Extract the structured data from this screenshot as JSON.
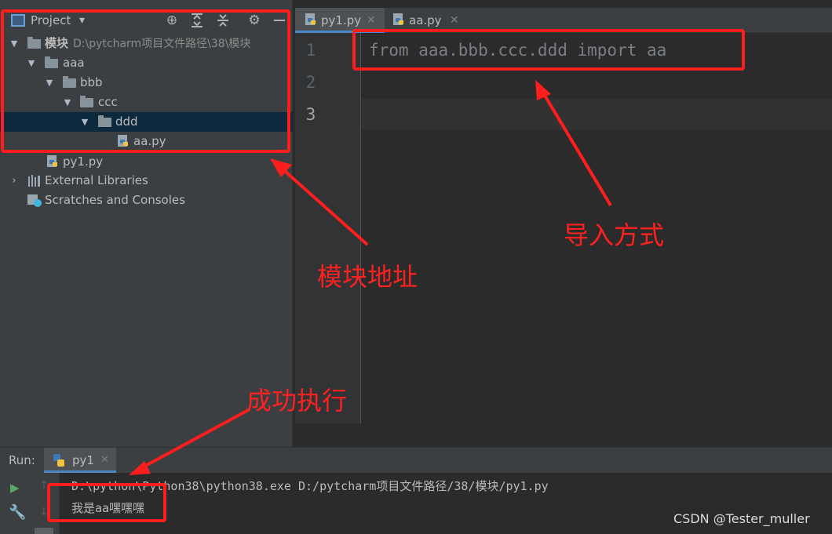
{
  "project_panel": {
    "title": "Project",
    "dropdown_glyph": "▾",
    "toolbar_icons": [
      "crosshair-icon",
      "expand-all-icon",
      "collapse-all-icon",
      "gear-icon",
      "minimize-icon"
    ],
    "tree": [
      {
        "label": "模块",
        "hint": "D:\\pytcharm项目文件路径\\38\\模块",
        "type": "folder",
        "expanded": true
      },
      {
        "label": "aaa",
        "type": "folder",
        "expanded": true
      },
      {
        "label": "bbb",
        "type": "folder",
        "expanded": true
      },
      {
        "label": "ccc",
        "type": "folder",
        "expanded": true
      },
      {
        "label": "ddd",
        "type": "folder",
        "expanded": true,
        "selected": true
      },
      {
        "label": "aa.py",
        "type": "python-file"
      },
      {
        "label": "py1.py",
        "type": "python-file"
      },
      {
        "label": "External Libraries",
        "type": "libraries",
        "expanded": false
      },
      {
        "label": "Scratches and Consoles",
        "type": "scratches"
      }
    ]
  },
  "editor": {
    "tabs": [
      {
        "label": "py1.py",
        "active": true
      },
      {
        "label": "aa.py",
        "active": false
      }
    ],
    "line_numbers": [
      "1",
      "2",
      "3"
    ],
    "code_lines": [
      "from aaa.bbb.ccc.ddd import aa",
      "",
      ""
    ]
  },
  "run_panel": {
    "label": "Run:",
    "tab": "py1",
    "console_lines": [
      "D:\\python\\Python38\\python38.exe D:/pytcharm项目文件路径/38/模块/py1.py",
      "我是aa嘿嘿嘿"
    ]
  },
  "annotations": {
    "module_address": "模块地址",
    "import_method": "导入方式",
    "success": "成功执行"
  },
  "watermark": "CSDN @Tester_muller",
  "colors": {
    "annotation_red": "#ff1e1e",
    "selection": "#0d293e",
    "background": "#2b2b2b",
    "panel": "#3c3f41"
  }
}
